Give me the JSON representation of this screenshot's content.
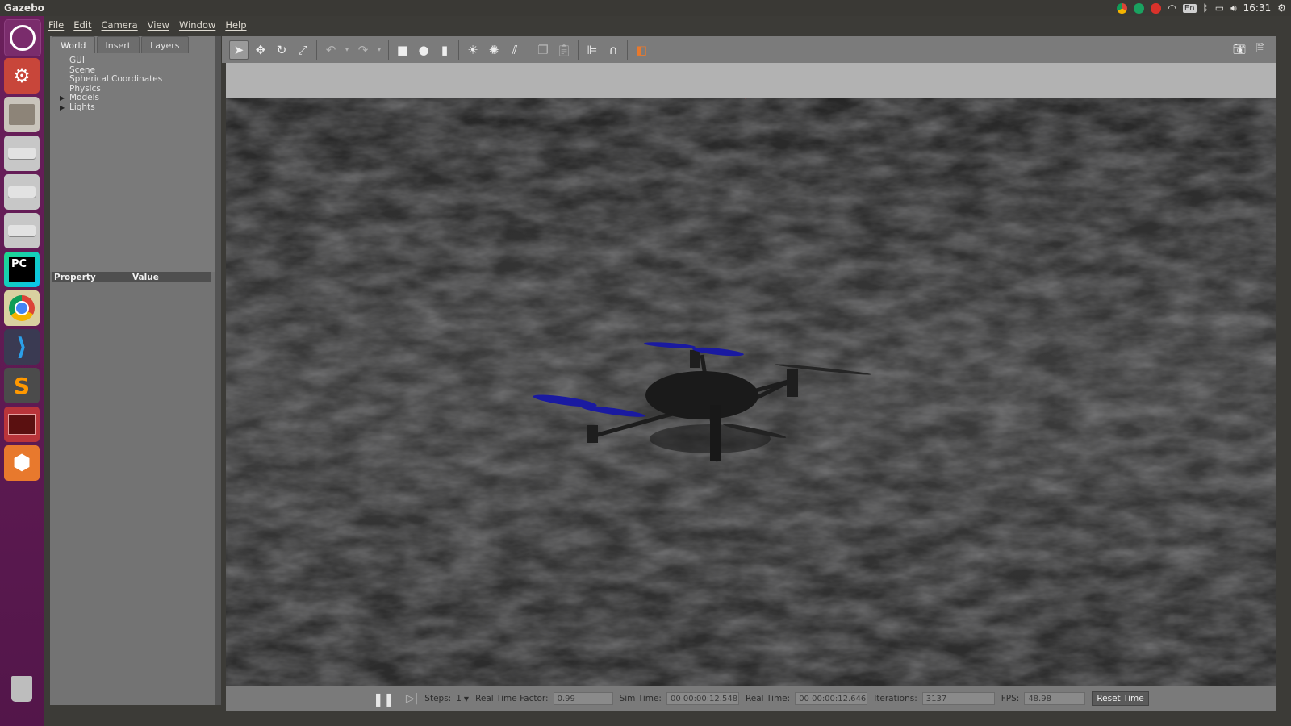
{
  "window": {
    "title": "Gazebo"
  },
  "tray": {
    "clock": "16:31",
    "keyboard": "En"
  },
  "menu": {
    "items": [
      "File",
      "Edit",
      "Camera",
      "View",
      "Window",
      "Help"
    ]
  },
  "panel": {
    "tabs": [
      "World",
      "Insert",
      "Layers"
    ],
    "tree": [
      "GUI",
      "Scene",
      "Spherical Coordinates",
      "Physics",
      "Models",
      "Lights"
    ],
    "property_header": "Property",
    "value_header": "Value"
  },
  "bottom": {
    "steps_label": "Steps:",
    "steps_value": "1",
    "rtf_label": "Real Time Factor:",
    "rtf_value": "0.99",
    "sim_label": "Sim Time:",
    "sim_value": "00 00:00:12.548",
    "real_label": "Real Time:",
    "real_value": "00 00:00:12.646",
    "iter_label": "Iterations:",
    "iter_value": "3137",
    "fps_label": "FPS:",
    "fps_value": "48.98",
    "reset_label": "Reset Time"
  },
  "launcher_icons": [
    "ubuntu-dash-icon",
    "system-settings-icon",
    "files-icon",
    "drive-icon",
    "drive-icon",
    "drive-icon",
    "pycharm-icon",
    "chrome-icon",
    "vscode-icon",
    "sublime-icon",
    "terminal-icon",
    "package-icon",
    "trash-icon"
  ],
  "pycharm_text": "PC",
  "colors": {
    "launcher": "#5b1a4f",
    "panel": "#7a7a7a",
    "ground": "#2e2e2e",
    "propeller": "#1a1aa0",
    "accent_orange": "#e8792d"
  }
}
